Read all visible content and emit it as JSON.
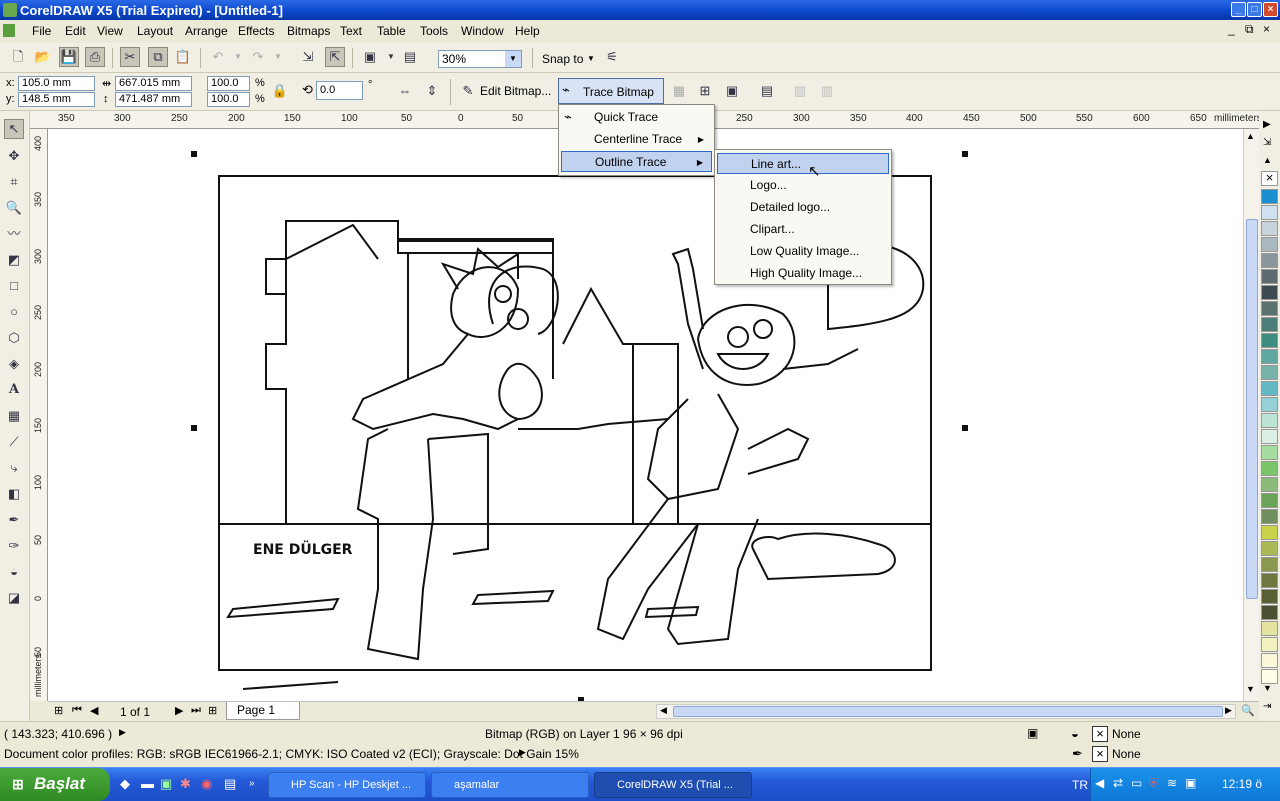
{
  "window": {
    "title": "CorelDRAW X5 (Trial Expired) - [Untitled-1]"
  },
  "menubar": [
    "File",
    "Edit",
    "View",
    "Layout",
    "Arrange",
    "Effects",
    "Bitmaps",
    "Text",
    "Table",
    "Tools",
    "Window",
    "Help"
  ],
  "toolbar": {
    "zoom": "30%",
    "snap_to": "Snap to"
  },
  "propbar": {
    "x_label": "x:",
    "y_label": "y:",
    "x": "105.0 mm",
    "y": "148.5 mm",
    "w": "667.015 mm",
    "h": "471.487 mm",
    "scale_w": "100.0",
    "scale_h": "100.0",
    "pct": "%",
    "angle": "0.0",
    "deg": "°",
    "edit_bitmap": "Edit Bitmap...",
    "trace_bitmap": "Trace Bitmap"
  },
  "trace_menu": {
    "items": [
      "Quick Trace",
      "Centerline Trace",
      "Outline Trace"
    ]
  },
  "outline_submenu": {
    "items": [
      "Line art...",
      "Logo...",
      "Detailed logo...",
      "Clipart...",
      "Low Quality Image...",
      "High Quality Image..."
    ]
  },
  "ruler": {
    "top": [
      "350",
      "300",
      "250",
      "200",
      "150",
      "100",
      "50",
      "0",
      "50",
      "250",
      "300",
      "350",
      "400",
      "450",
      "500",
      "550",
      "600",
      "650"
    ],
    "unit": "millimeters",
    "left": [
      "400",
      "350",
      "300",
      "250",
      "200",
      "150",
      "100",
      "50",
      "0",
      "50"
    ],
    "left_unit": "millimeters"
  },
  "drawing": {
    "signature": "ENE DÜLGER"
  },
  "pagebar": {
    "pages": "1 of 1",
    "tab": "Page 1"
  },
  "status": {
    "coords": "( 143.323; 410.696 )",
    "object_info": "Bitmap (RGB) on Layer 1 96 × 96 dpi",
    "color_profiles": "Document color profiles: RGB: sRGB IEC61966-2.1; CMYK: ISO Coated v2 (ECI); Grayscale: Dot Gain 15%",
    "fill": "None",
    "outline": "None"
  },
  "taskbar": {
    "start": "Başlat",
    "tasks": [
      "HP Scan - HP Deskjet ...",
      "aşamalar",
      "CorelDRAW X5 (Trial ..."
    ],
    "lang": "TR",
    "time": "12:19 ö"
  },
  "palette": [
    "#ffffff",
    "#1b8fd0",
    "#cfe1ef",
    "#c7d4db",
    "#aab8c0",
    "#8a989e",
    "#5d6a70",
    "#3d4a50",
    "#5a7270",
    "#4d7e7a",
    "#3f8c80",
    "#5fa7a0",
    "#77b2a8",
    "#62b8c5",
    "#95d0d6",
    "#bde2d6",
    "#dcefe4",
    "#a7dca0",
    "#7ac56a",
    "#8cba7a",
    "#6aa458",
    "#6f8f5f",
    "#c8d24a",
    "#aab858",
    "#8a9850",
    "#6e7840",
    "#5a6034",
    "#4a5030",
    "#e4e4a0",
    "#f2f2c0",
    "#faf8d8",
    "#ffffe8"
  ]
}
